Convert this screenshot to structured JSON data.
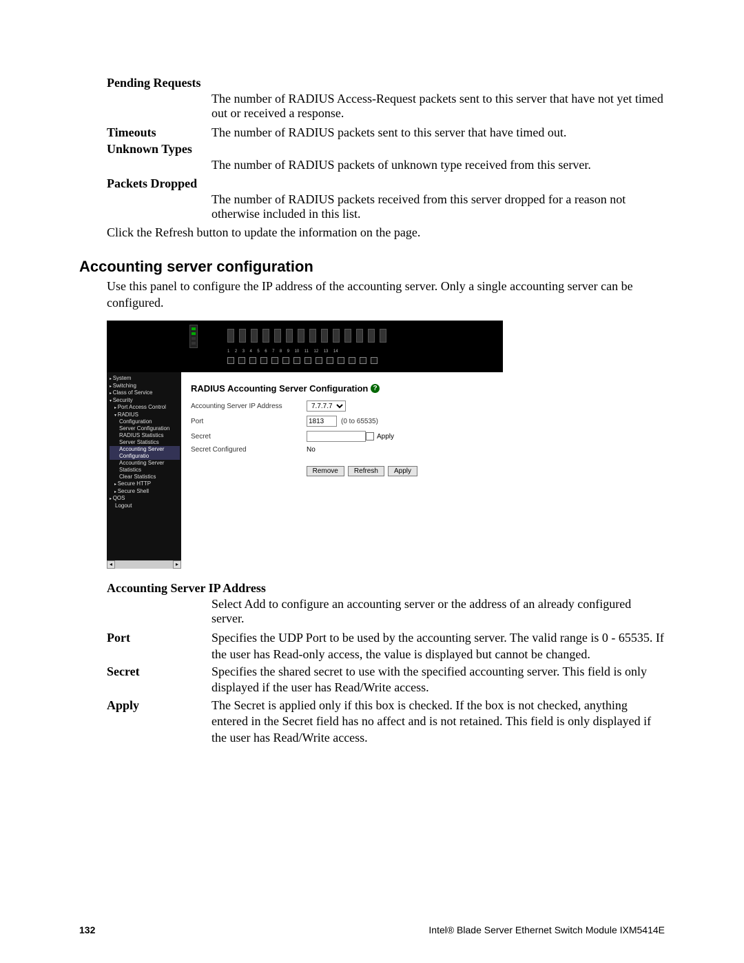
{
  "defs_top": {
    "pending_requests_term": "Pending Requests",
    "pending_requests_body": "The number of RADIUS Access-Request packets sent to this server that have not yet timed out or received a response.",
    "timeouts_term": "Timeouts",
    "timeouts_body": "The number of RADIUS packets sent to this server that have timed out.",
    "unknown_types_term": "Unknown Types",
    "unknown_types_body": "The number of RADIUS packets of unknown type received from this server.",
    "packets_dropped_term": "Packets Dropped",
    "packets_dropped_body": "The number of RADIUS packets received from this server dropped for a reason not otherwise included in this list.",
    "refresh_note": "Click the Refresh button to update the information on the page."
  },
  "section": {
    "heading": "Accounting server configuration",
    "intro": "Use this panel to configure the IP address of the accounting server. Only a single accounting server can be configured."
  },
  "screenshot": {
    "ports": [
      "1",
      "2",
      "3",
      "4",
      "5",
      "6",
      "7",
      "8",
      "9",
      "10",
      "11",
      "12",
      "13",
      "14"
    ],
    "nav": {
      "system": "System",
      "switching": "Switching",
      "cos": "Class of Service",
      "security": "Security",
      "pac": "Port Access Control",
      "radius": "RADIUS",
      "configuration": "Configuration",
      "server_config": "Server Configuration",
      "radius_stats": "RADIUS Statistics",
      "server_stats": "Server Statistics",
      "acct_srv_config": "Accounting Server Configuratio",
      "acct_srv_stats": "Accounting Server Statistics",
      "clear_stats": "Clear Statistics",
      "secure_http": "Secure HTTP",
      "secure_shell": "Secure Shell",
      "qos": "QOS",
      "logout": "Logout"
    },
    "panel": {
      "title": "RADIUS Accounting Server Configuration",
      "help": "?",
      "rows": {
        "ip_label": "Accounting Server IP Address",
        "ip_value": "7.7.7.7",
        "port_label": "Port",
        "port_value": "1813",
        "port_range": "(0 to 65535)",
        "secret_label": "Secret",
        "apply_check_label": "Apply",
        "secret_configured_label": "Secret Configured",
        "secret_configured_value": "No"
      },
      "buttons": {
        "remove": "Remove",
        "refresh": "Refresh",
        "apply": "Apply"
      }
    }
  },
  "defs_bottom": {
    "ip_term": "Accounting Server IP Address",
    "ip_body": "Select Add to configure an accounting server or the address of an already configured server.",
    "port_term": "Port",
    "port_body": "Specifies the UDP Port to be used by the accounting server. The valid range is 0 - 65535. If the user has Read-only access, the value is displayed but cannot be changed.",
    "secret_term": "Secret",
    "secret_body": "Specifies the shared secret to use with the specified accounting server. This field is only displayed if the user has Read/Write access.",
    "apply_term": "Apply",
    "apply_body": "The Secret is applied only if this box is checked. If the box is not checked, anything entered in the Secret field has no affect and is not retained. This field is only displayed if the user has Read/Write access."
  },
  "footer": {
    "page": "132",
    "title": "Intel® Blade Server Ethernet Switch Module IXM5414E"
  }
}
